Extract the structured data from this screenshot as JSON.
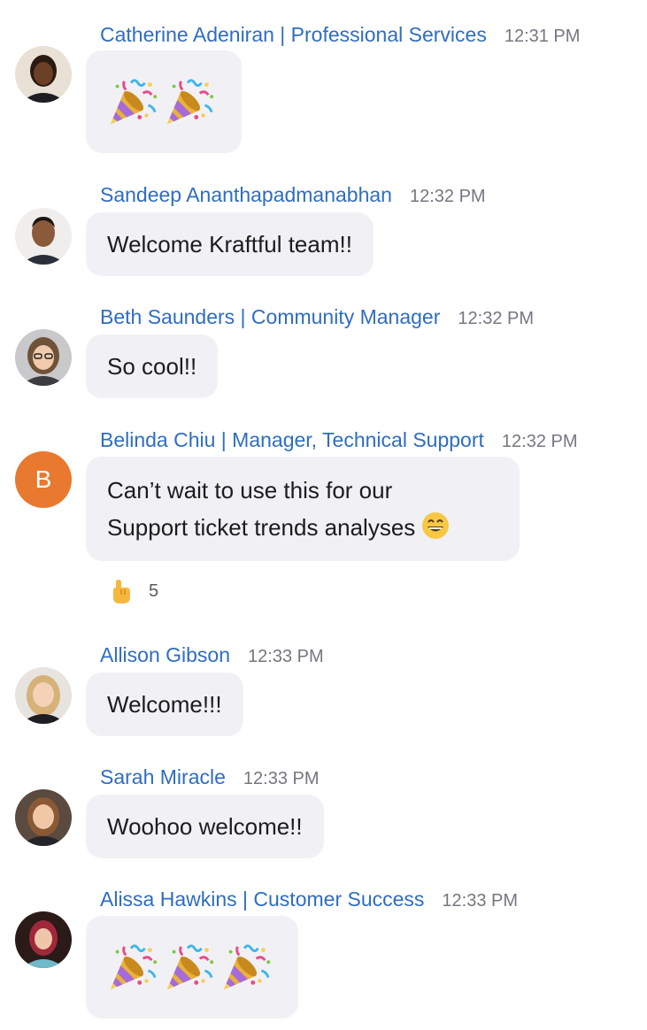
{
  "messages": [
    {
      "sender": "Catherine Adeniran | Professional Services",
      "time": "12:31 PM",
      "avatar": "photo-avatar",
      "content_type": "emoji",
      "emojis": [
        "party-popper-icon",
        "party-popper-icon"
      ]
    },
    {
      "sender": "Sandeep Ananthapadmanabhan",
      "time": "12:32 PM",
      "avatar": "photo-avatar",
      "content_type": "text",
      "text": "Welcome Kraftful team!!"
    },
    {
      "sender": "Beth Saunders | Community Manager",
      "time": "12:32 PM",
      "avatar": "photo-avatar",
      "content_type": "text",
      "text": "So cool!!"
    },
    {
      "sender": "Belinda Chiu | Manager, Technical Support",
      "time": "12:32 PM",
      "avatar_letter": "B",
      "avatar_color": "#e8792e",
      "content_type": "text",
      "lines": [
        "Can’t wait to use this for our",
        "Support ticket trends analyses"
      ],
      "trailing_emoji": "grinning-face-icon",
      "reaction": {
        "emoji": "pointing-up-hand-icon",
        "count": "5"
      }
    },
    {
      "sender": "Allison Gibson",
      "time": "12:33 PM",
      "avatar": "photo-avatar",
      "content_type": "text",
      "text": "Welcome!!!"
    },
    {
      "sender": "Sarah Miracle",
      "time": "12:33 PM",
      "avatar": "photo-avatar",
      "content_type": "text",
      "text": "Woohoo welcome!!"
    },
    {
      "sender": "Alissa Hawkins | Customer Success",
      "time": "12:33 PM",
      "avatar": "photo-avatar",
      "content_type": "emoji",
      "emojis": [
        "party-popper-icon",
        "party-popper-icon",
        "party-popper-icon"
      ]
    }
  ],
  "colors": {
    "sender_link": "#2f6dc1",
    "timestamp": "#767680",
    "bubble_background": "#f1f1f5"
  }
}
